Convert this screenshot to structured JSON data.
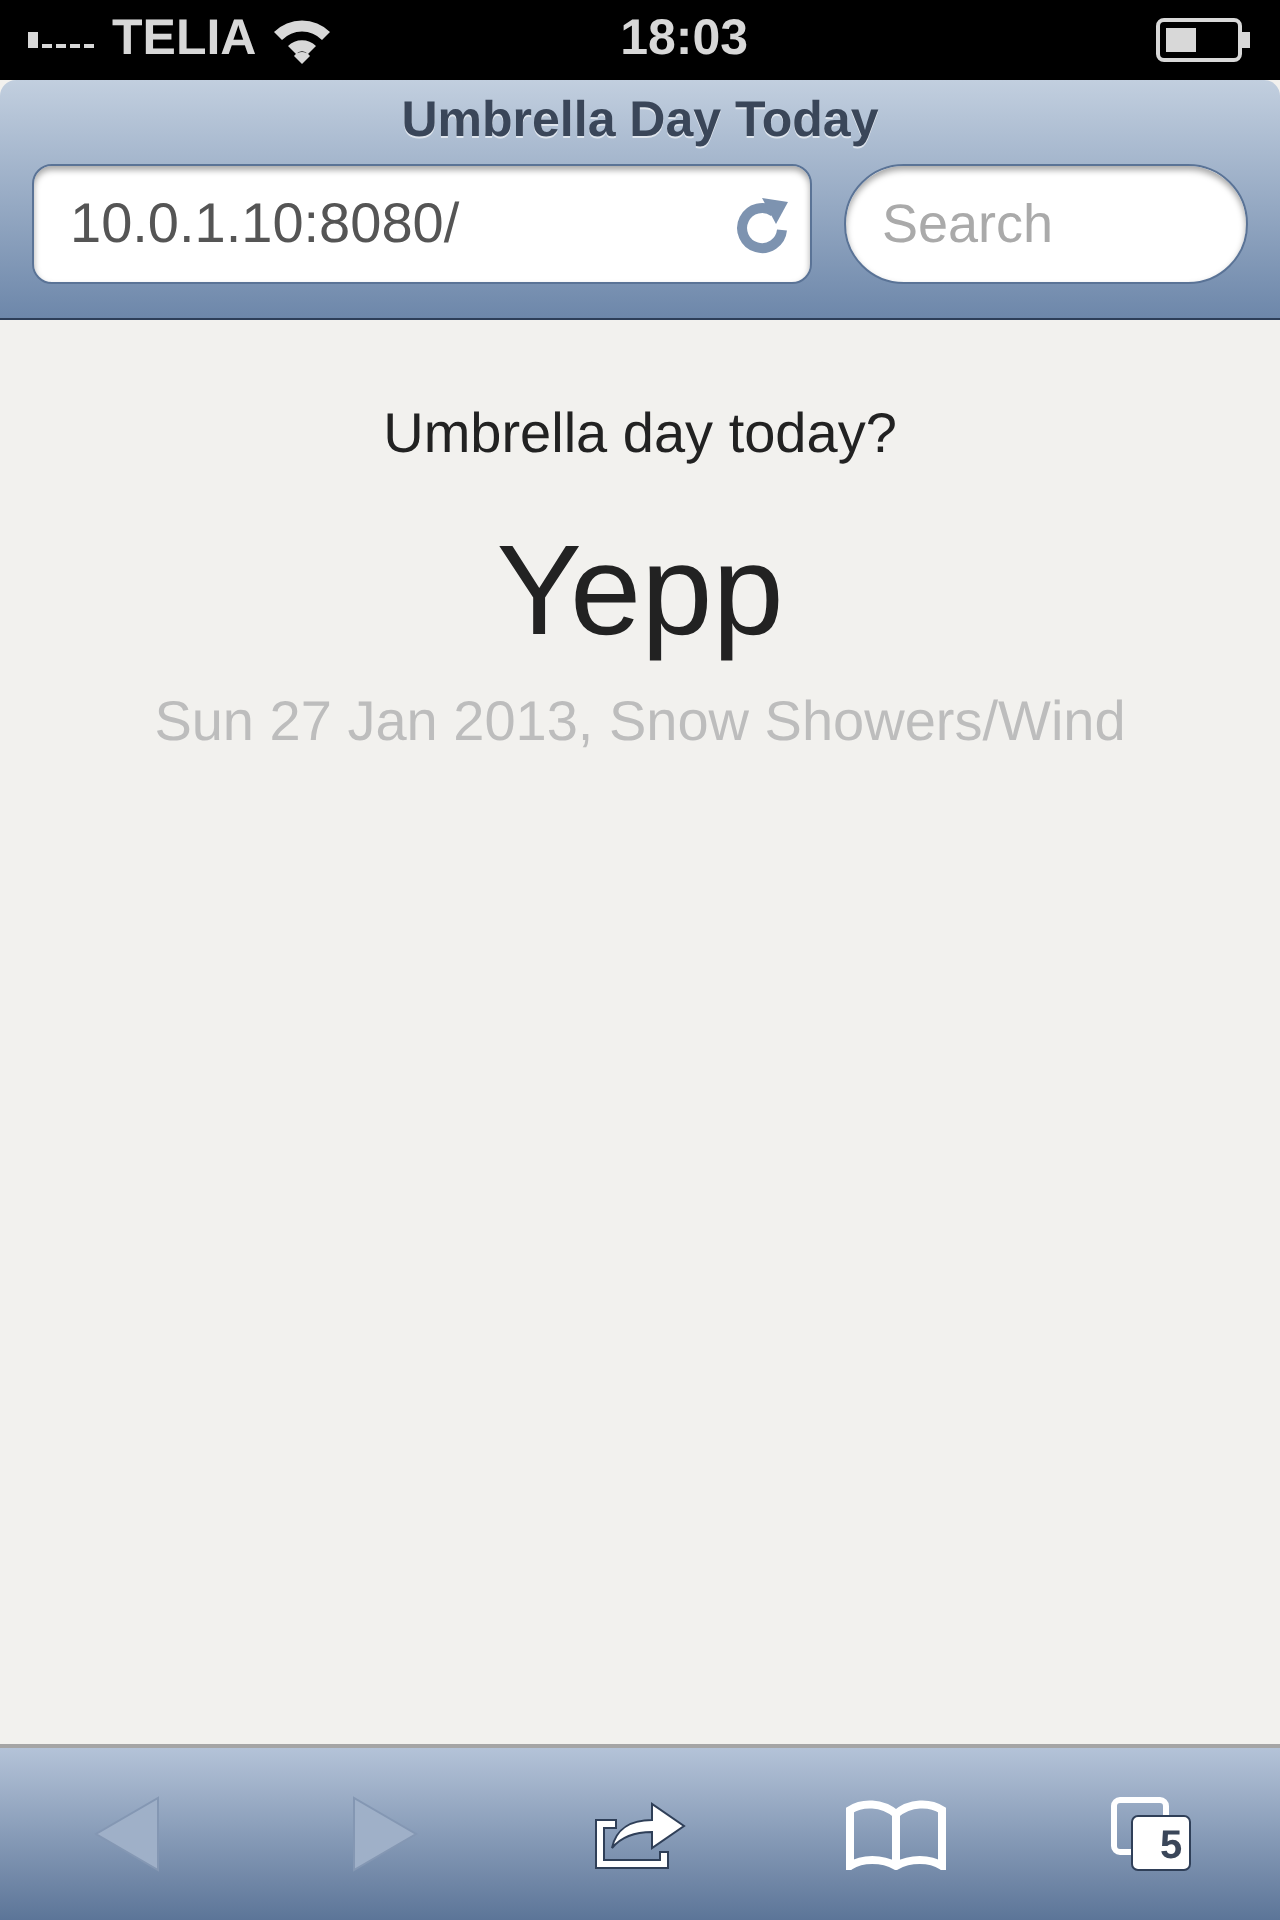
{
  "status_bar": {
    "carrier": "TELIA",
    "time": "18:03"
  },
  "browser": {
    "title": "Umbrella Day Today",
    "url": "10.0.1.10:8080/",
    "search": {
      "placeholder": "Search"
    }
  },
  "page": {
    "question": "Umbrella day today?",
    "answer": "Yepp",
    "detail": "Sun 27 Jan 2013, Snow Showers/Wind"
  },
  "toolbar": {
    "buttons": [
      {
        "kind": "back",
        "disabled": true
      },
      {
        "kind": "forward",
        "disabled": true
      },
      {
        "kind": "share",
        "disabled": false
      },
      {
        "kind": "bookmarks",
        "disabled": false
      },
      {
        "kind": "tabs",
        "disabled": false,
        "count": "5"
      }
    ]
  }
}
